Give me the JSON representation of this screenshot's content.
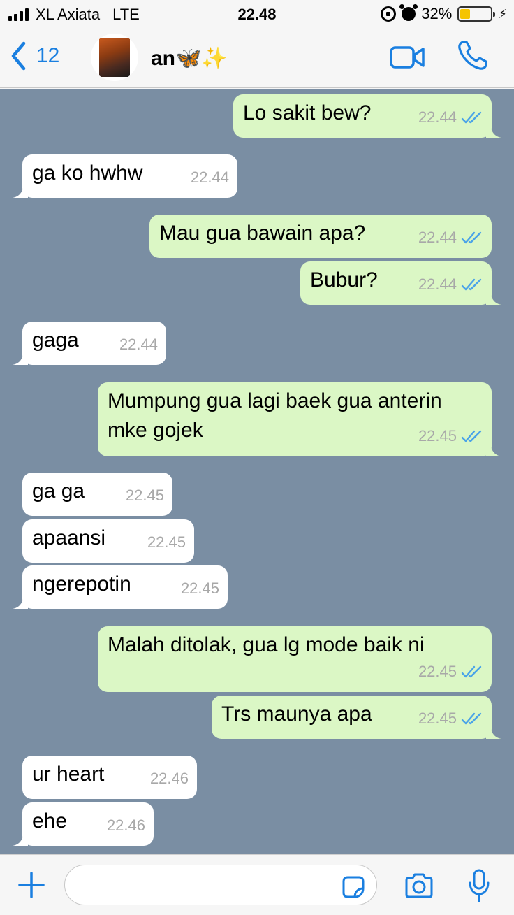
{
  "status_bar": {
    "carrier": "XL Axiata",
    "network": "LTE",
    "time": "22.48",
    "battery": "32%",
    "battery_level": 0.32
  },
  "header": {
    "back_count": "12",
    "contact_name": "an🦋✨"
  },
  "messages": [
    {
      "dir": "out",
      "text": "Lo sakit bew?",
      "time": "22.44",
      "read": true
    },
    {
      "dir": "in",
      "text": "ga ko hwhw",
      "time": "22.44"
    },
    {
      "dir": "out",
      "text": "Mau gua bawain apa?",
      "time": "22.44",
      "read": true
    },
    {
      "dir": "out",
      "text": "Bubur?",
      "time": "22.44",
      "read": true
    },
    {
      "dir": "in",
      "text": "gaga",
      "time": "22.44"
    },
    {
      "dir": "out",
      "text": "Mumpung gua lagi baek gua anterin mke gojek",
      "time": "22.45",
      "read": true
    },
    {
      "dir": "in",
      "text": "ga ga",
      "time": "22.45"
    },
    {
      "dir": "in",
      "text": "apaansi",
      "time": "22.45"
    },
    {
      "dir": "in",
      "text": "ngerepotin",
      "time": "22.45"
    },
    {
      "dir": "out",
      "text": "Malah ditolak, gua lg mode baik ni",
      "time": "22.45",
      "read": true
    },
    {
      "dir": "out",
      "text": "Trs maunya apa",
      "time": "22.45",
      "read": true
    },
    {
      "dir": "in",
      "text": "ur heart",
      "time": "22.46"
    },
    {
      "dir": "in",
      "text": "ehe",
      "time": "22.46"
    }
  ],
  "input": {
    "value": ""
  },
  "colors": {
    "accent": "#1a7fe0",
    "chat_background": "#7a8ea3",
    "outgoing_bubble": "#dbf7c5",
    "incoming_bubble": "#ffffff",
    "read_ticks": "#4aa3e8",
    "battery_fill": "#f5c400"
  },
  "icons": [
    "back-chevron-icon",
    "video-call-icon",
    "phone-icon",
    "plus-icon",
    "sticker-icon",
    "camera-icon",
    "microphone-icon",
    "double-check-icon"
  ]
}
